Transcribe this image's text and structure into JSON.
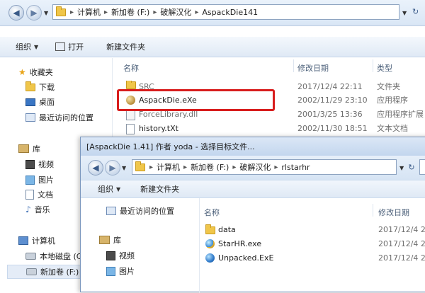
{
  "explorer": {
    "breadcrumb": [
      "计算机",
      "新加卷 (F:)",
      "破解汉化",
      "AspackDie141"
    ],
    "toolbar": {
      "organize": "组织",
      "open": "打开",
      "new_folder": "新建文件夹"
    },
    "sidebar": {
      "favorites": "收藏夹",
      "downloads": "下载",
      "desktop": "桌面",
      "recent": "最近访问的位置",
      "libraries": "库",
      "videos": "视频",
      "pictures": "图片",
      "documents": "文档",
      "music": "音乐",
      "computer": "计算机",
      "local_disk": "本地磁盘 (C",
      "new_volume": "新加卷 (F:)"
    },
    "columns": {
      "name": "名称",
      "modified": "修改日期",
      "type": "类型"
    },
    "files": [
      {
        "name": "SRC",
        "modified": "2017/12/4 22:11",
        "type": "文件夹",
        "icon": "folder-icon"
      },
      {
        "name": "AspackDie.eXe",
        "modified": "2002/11/29 23:10",
        "type": "应用程序",
        "icon": "exe-icon"
      },
      {
        "name": "ForceLibrary.dll",
        "modified": "2001/3/25 13:36",
        "type": "应用程序扩展",
        "icon": "dll-icon"
      },
      {
        "name": "history.tXt",
        "modified": "2002/11/30 18:51",
        "type": "文本文档",
        "icon": "text-file-icon"
      }
    ]
  },
  "dialog": {
    "title": "[AspackDie 1.41] 作者 yoda - 选择目标文件...",
    "breadcrumb": [
      "计算机",
      "新加卷 (F:)",
      "破解汉化",
      "rlstarhr"
    ],
    "toolbar": {
      "organize": "组织",
      "new_folder": "新建文件夹"
    },
    "sidebar": {
      "recent": "最近访问的位置",
      "libraries": "库",
      "videos": "视频",
      "pictures": "图片"
    },
    "columns": {
      "name": "名称",
      "modified": "修改日期"
    },
    "files": [
      {
        "name": "data",
        "modified": "2017/12/4 2",
        "icon": "folder-icon"
      },
      {
        "name": "StarHR.exe",
        "modified": "2017/12/4 2",
        "icon": "app-icon"
      },
      {
        "name": "Unpacked.ExE",
        "modified": "2017/12/4 2",
        "icon": "app-icon"
      }
    ]
  },
  "highlight_color": "#d81d1d"
}
